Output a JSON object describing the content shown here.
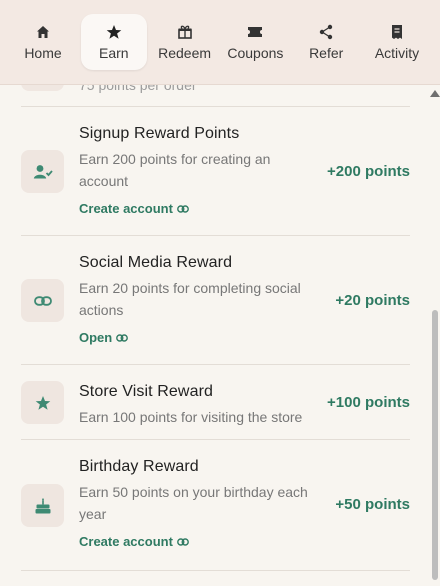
{
  "nav": {
    "tabs": [
      {
        "label": "Home",
        "icon": "home-icon"
      },
      {
        "label": "Earn",
        "icon": "star-icon",
        "active": true
      },
      {
        "label": "Redeem",
        "icon": "gift-icon"
      },
      {
        "label": "Coupons",
        "icon": "coupon-icon"
      },
      {
        "label": "Refer",
        "icon": "share-icon"
      },
      {
        "label": "Activity",
        "icon": "receipt-icon"
      }
    ]
  },
  "partial_row": {
    "text": "75 points per order"
  },
  "rewards": [
    {
      "title": "Signup Reward Points",
      "description": "Earn 200 points for creating an account",
      "points": "+200 points",
      "link": "Create account",
      "icon": "user-check-icon"
    },
    {
      "title": "Social Media Reward",
      "description": "Earn 20 points for completing social actions",
      "points": "+20 points",
      "link": "Open",
      "icon": "link-icon"
    },
    {
      "title": "Store Visit Reward",
      "description": "Earn 100 points for visiting the store",
      "points": "+100 points",
      "icon": "star-icon"
    },
    {
      "title": "Birthday Reward",
      "description": "Earn 50 points on your birthday each year",
      "points": "+50 points",
      "link": "Create account",
      "icon": "cake-icon"
    }
  ],
  "colors": {
    "accent": "#2f7a62",
    "nav_bg": "#f3e9e3",
    "page_bg": "#f8f5f0",
    "icon_tile": "#efe6e0"
  }
}
